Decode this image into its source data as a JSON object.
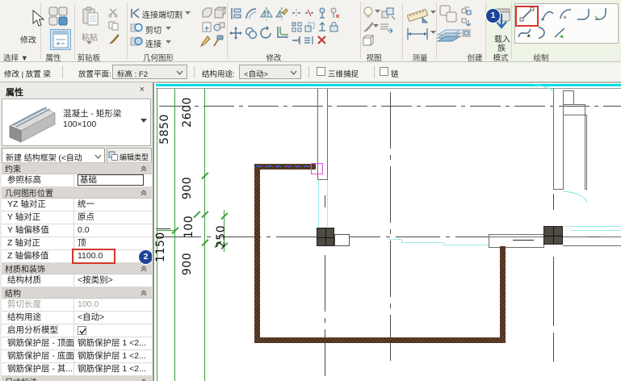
{
  "ribbon": {
    "select": {
      "button_label": "修改",
      "label": "选择 ▼"
    },
    "properties": {
      "label": "属性"
    },
    "clipboard": {
      "paste_label": "粘贴",
      "label": "剪贴板"
    },
    "geometry": {
      "row1_label": "连接端切割",
      "row2_label": "剪切",
      "row3_label": "连接",
      "label": "几何图形"
    },
    "modify": {
      "label": "修改"
    },
    "view": {
      "label": "视图"
    },
    "measure": {
      "label": "测量"
    },
    "create": {
      "label": "创建"
    },
    "mode": {
      "load_family_line1": "载入",
      "load_family_line2": "族",
      "label": "模式"
    },
    "draw": {
      "label": "绘制"
    },
    "badge1": "1"
  },
  "options_bar": {
    "context": "修改 | 放置 梁",
    "placement_plane_label": "放置平面:",
    "placement_plane_value": "标高 : F2",
    "structural_usage_label": "结构用途:",
    "structural_usage_value": "<自动>",
    "checkbox_3d_snap": "三维捕捉",
    "checkbox_chain": "链"
  },
  "properties_panel": {
    "title": "属性",
    "close": "×",
    "type_name": "混凝土 - 矩形梁",
    "type_size": "100×100",
    "selector_value": "新建 结构框架 (<自动",
    "edit_type_label": "编辑类型",
    "badge2": "2",
    "sections": [
      {
        "header": "约束",
        "rows": [
          {
            "label": "参照标高",
            "value": "基础",
            "selected": true
          }
        ]
      },
      {
        "header": "几何图形位置",
        "rows": [
          {
            "label": "YZ 轴对正",
            "value": "统一"
          },
          {
            "label": "Y 轴对正",
            "value": "原点"
          },
          {
            "label": "Y 轴偏移值",
            "value": "0.0"
          },
          {
            "label": "Z 轴对正",
            "value": "顶"
          },
          {
            "label": "Z 轴偏移值",
            "value": "1100.0",
            "highlighted": true
          }
        ]
      },
      {
        "header": "材质和装饰",
        "rows": [
          {
            "label": "结构材质",
            "value": "<按类别>"
          }
        ]
      },
      {
        "header": "结构",
        "rows": [
          {
            "label": "剪切长度",
            "value": "100.0",
            "disabled": true
          },
          {
            "label": "结构用途",
            "value": "<自动>"
          },
          {
            "label": "启用分析模型",
            "checkbox": true,
            "checked": true
          },
          {
            "label": "钢筋保护层 - 顶面",
            "value": "钢筋保护层 1 <2..."
          },
          {
            "label": "钢筋保护层 - 底面",
            "value": "钢筋保护层 1 <2..."
          },
          {
            "label": "钢筋保护层 - 其...",
            "value": "钢筋保护层 1 <2..."
          }
        ]
      },
      {
        "header": "尺寸标注",
        "rows": []
      }
    ]
  },
  "canvas": {
    "dimension_texts": {
      "d1": "5850",
      "d2": "1150",
      "d3": "2600",
      "d4": "900",
      "d5": "100",
      "d6": "900",
      "d7": "250"
    },
    "colors": {
      "crop_line": "#00dfe3",
      "dimension_green": "#3aa13a",
      "beam_brown": "#583a2b",
      "sketch_blue": "#3a55b8",
      "snap_box_magenta": "#e44fe4",
      "wall_gray": "#6b6b6b",
      "column_dark": "#4e4a44",
      "highlight_red": "#d4372c",
      "badge_blue": "#1d4399"
    }
  }
}
